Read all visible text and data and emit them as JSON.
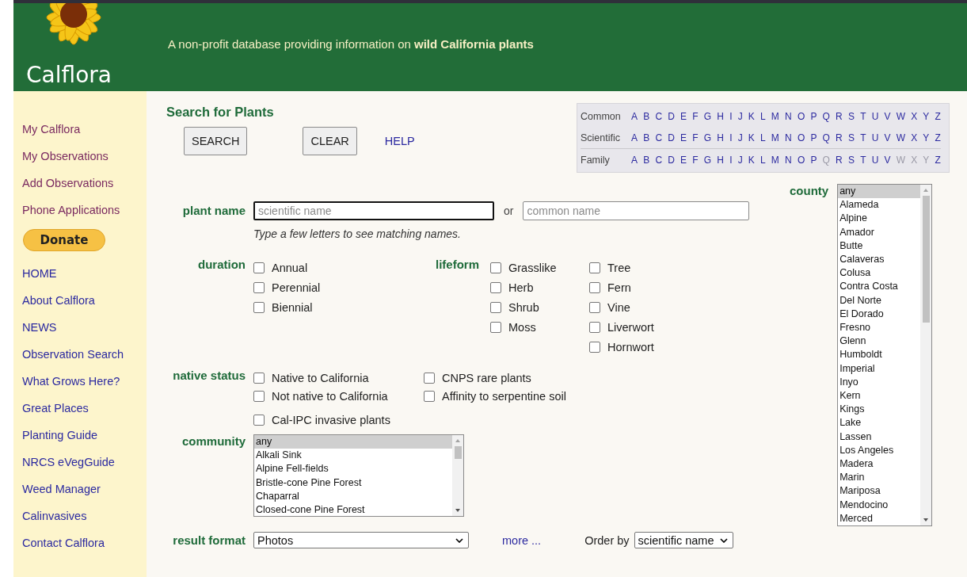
{
  "header": {
    "logo_text": "Calflora",
    "tagline": "A non-profit database providing information on **wild California plants**"
  },
  "sidebar": {
    "items": [
      {
        "label": "My Calflora",
        "kind": "account_link"
      },
      {
        "label": "My Observations",
        "kind": "account_link"
      },
      {
        "label": "Add Observations",
        "kind": "account_link"
      },
      {
        "label": "Phone Applications",
        "kind": "account_link"
      },
      {
        "label": "Donate",
        "kind": "donate"
      },
      {
        "label": "HOME",
        "kind": "link"
      },
      {
        "label": "About Calflora",
        "kind": "link"
      },
      {
        "label": "NEWS",
        "kind": "link"
      },
      {
        "label": "Observation Search",
        "kind": "link"
      },
      {
        "label": "What Grows Here?",
        "kind": "link"
      },
      {
        "label": "Great Places",
        "kind": "link"
      },
      {
        "label": "Planting Guide",
        "kind": "link"
      },
      {
        "label": "NRCS eVegGuide",
        "kind": "link"
      },
      {
        "label": "Weed Manager",
        "kind": "link"
      },
      {
        "label": "Calinvasives",
        "kind": "link"
      },
      {
        "label": "Contact Calflora",
        "kind": "link"
      }
    ]
  },
  "search": {
    "title": "Search for Plants",
    "buttons": [
      {
        "label": "SEARCH",
        "kind": "button"
      },
      {
        "label": "CLEAR",
        "kind": "button"
      },
      {
        "label": "HELP",
        "kind": "link"
      }
    ]
  },
  "alphabet": [
    {
      "label": "Common",
      "letters": [
        {
          "letter": "A",
          "disabled": false
        },
        {
          "letter": "B",
          "disabled": false
        },
        {
          "letter": "C",
          "disabled": false
        },
        {
          "letter": "D",
          "disabled": false
        },
        {
          "letter": "E",
          "disabled": false
        },
        {
          "letter": "F",
          "disabled": false
        },
        {
          "letter": "G",
          "disabled": false
        },
        {
          "letter": "H",
          "disabled": false
        },
        {
          "letter": "I",
          "disabled": false
        },
        {
          "letter": "J",
          "disabled": false
        },
        {
          "letter": "K",
          "disabled": false
        },
        {
          "letter": "L",
          "disabled": false
        },
        {
          "letter": "M",
          "disabled": false
        },
        {
          "letter": "N",
          "disabled": false
        },
        {
          "letter": "O",
          "disabled": false
        },
        {
          "letter": "P",
          "disabled": false
        },
        {
          "letter": "Q",
          "disabled": false
        },
        {
          "letter": "R",
          "disabled": false
        },
        {
          "letter": "S",
          "disabled": false
        },
        {
          "letter": "T",
          "disabled": false
        },
        {
          "letter": "U",
          "disabled": false
        },
        {
          "letter": "V",
          "disabled": false
        },
        {
          "letter": "W",
          "disabled": false
        },
        {
          "letter": "X",
          "disabled": false
        },
        {
          "letter": "Y",
          "disabled": false
        },
        {
          "letter": "Z",
          "disabled": false
        }
      ]
    },
    {
      "label": "Scientific",
      "letters": [
        {
          "letter": "A",
          "disabled": false
        },
        {
          "letter": "B",
          "disabled": false
        },
        {
          "letter": "C",
          "disabled": false
        },
        {
          "letter": "D",
          "disabled": false
        },
        {
          "letter": "E",
          "disabled": false
        },
        {
          "letter": "F",
          "disabled": false
        },
        {
          "letter": "G",
          "disabled": false
        },
        {
          "letter": "H",
          "disabled": false
        },
        {
          "letter": "I",
          "disabled": false
        },
        {
          "letter": "J",
          "disabled": false
        },
        {
          "letter": "K",
          "disabled": false
        },
        {
          "letter": "L",
          "disabled": false
        },
        {
          "letter": "M",
          "disabled": false
        },
        {
          "letter": "N",
          "disabled": false
        },
        {
          "letter": "O",
          "disabled": false
        },
        {
          "letter": "P",
          "disabled": false
        },
        {
          "letter": "Q",
          "disabled": false
        },
        {
          "letter": "R",
          "disabled": false
        },
        {
          "letter": "S",
          "disabled": false
        },
        {
          "letter": "T",
          "disabled": false
        },
        {
          "letter": "U",
          "disabled": false
        },
        {
          "letter": "V",
          "disabled": false
        },
        {
          "letter": "W",
          "disabled": false
        },
        {
          "letter": "X",
          "disabled": false
        },
        {
          "letter": "Y",
          "disabled": false
        },
        {
          "letter": "Z",
          "disabled": false
        }
      ]
    },
    {
      "label": "Family",
      "letters": [
        {
          "letter": "A",
          "disabled": false
        },
        {
          "letter": "B",
          "disabled": false
        },
        {
          "letter": "C",
          "disabled": false
        },
        {
          "letter": "D",
          "disabled": false
        },
        {
          "letter": "E",
          "disabled": false
        },
        {
          "letter": "F",
          "disabled": false
        },
        {
          "letter": "G",
          "disabled": false
        },
        {
          "letter": "H",
          "disabled": false
        },
        {
          "letter": "I",
          "disabled": false
        },
        {
          "letter": "J",
          "disabled": false
        },
        {
          "letter": "K",
          "disabled": false
        },
        {
          "letter": "L",
          "disabled": false
        },
        {
          "letter": "M",
          "disabled": false
        },
        {
          "letter": "N",
          "disabled": false
        },
        {
          "letter": "O",
          "disabled": false
        },
        {
          "letter": "P",
          "disabled": false
        },
        {
          "letter": "Q",
          "disabled": true
        },
        {
          "letter": "R",
          "disabled": false
        },
        {
          "letter": "S",
          "disabled": false
        },
        {
          "letter": "T",
          "disabled": false
        },
        {
          "letter": "U",
          "disabled": false
        },
        {
          "letter": "V",
          "disabled": false
        },
        {
          "letter": "W",
          "disabled": true
        },
        {
          "letter": "X",
          "disabled": true
        },
        {
          "letter": "Y",
          "disabled": true
        },
        {
          "letter": "Z",
          "disabled": false
        }
      ]
    }
  ],
  "plant_name": {
    "label": "plant name",
    "scientific_placeholder": "scientific name",
    "separator": "or",
    "common_placeholder": "common name",
    "hint": "Type a few letters to see matching names."
  },
  "duration": {
    "label": "duration",
    "options": [
      {
        "label": "Annual",
        "checked": false
      },
      {
        "label": "Perennial",
        "checked": false
      },
      {
        "label": "Biennial",
        "checked": false
      }
    ]
  },
  "lifeform": {
    "label": "lifeform",
    "columns": [
      [
        {
          "label": "Grasslike",
          "checked": false
        },
        {
          "label": "Herb",
          "checked": false
        },
        {
          "label": "Shrub",
          "checked": false
        },
        {
          "label": "Moss",
          "checked": false
        }
      ],
      [
        {
          "label": "Tree",
          "checked": false
        },
        {
          "label": "Fern",
          "checked": false
        },
        {
          "label": "Vine",
          "checked": false
        },
        {
          "label": "Liverwort",
          "checked": false
        },
        {
          "label": "Hornwort",
          "checked": false
        }
      ]
    ]
  },
  "native_status": {
    "label": "native status",
    "columns": [
      [
        {
          "label": "Native to California",
          "checked": false
        },
        {
          "label": "Not native to California",
          "checked": false
        }
      ],
      [
        {
          "label": "CNPS rare plants",
          "checked": false
        },
        {
          "label": "Affinity to serpentine soil",
          "checked": false
        }
      ]
    ],
    "extra": {
      "label": "Cal-IPC invasive plants",
      "checked": false
    }
  },
  "community": {
    "label": "community",
    "items": [
      {
        "label": "any",
        "selected": true
      },
      {
        "label": "Alkali Sink",
        "selected": false
      },
      {
        "label": "Alpine Fell-fields",
        "selected": false
      },
      {
        "label": "Bristle-cone Pine Forest",
        "selected": false
      },
      {
        "label": "Chaparral",
        "selected": false
      },
      {
        "label": "Closed-cone Pine Forest",
        "selected": false
      }
    ]
  },
  "county": {
    "label": "county",
    "items": [
      {
        "label": "any",
        "selected": true
      },
      {
        "label": "Alameda",
        "selected": false
      },
      {
        "label": "Alpine",
        "selected": false
      },
      {
        "label": "Amador",
        "selected": false
      },
      {
        "label": "Butte",
        "selected": false
      },
      {
        "label": "Calaveras",
        "selected": false
      },
      {
        "label": "Colusa",
        "selected": false
      },
      {
        "label": "Contra Costa",
        "selected": false
      },
      {
        "label": "Del Norte",
        "selected": false
      },
      {
        "label": "El Dorado",
        "selected": false
      },
      {
        "label": "Fresno",
        "selected": false
      },
      {
        "label": "Glenn",
        "selected": false
      },
      {
        "label": "Humboldt",
        "selected": false
      },
      {
        "label": "Imperial",
        "selected": false
      },
      {
        "label": "Inyo",
        "selected": false
      },
      {
        "label": "Kern",
        "selected": false
      },
      {
        "label": "Kings",
        "selected": false
      },
      {
        "label": "Lake",
        "selected": false
      },
      {
        "label": "Lassen",
        "selected": false
      },
      {
        "label": "Los Angeles",
        "selected": false
      },
      {
        "label": "Madera",
        "selected": false
      },
      {
        "label": "Marin",
        "selected": false
      },
      {
        "label": "Mariposa",
        "selected": false
      },
      {
        "label": "Mendocino",
        "selected": false
      },
      {
        "label": "Merced",
        "selected": false
      }
    ]
  },
  "result_format": {
    "label": "result format",
    "value": "Photos",
    "more_link": "more ...",
    "order_label": "Order by",
    "order_value": "scientific name"
  }
}
